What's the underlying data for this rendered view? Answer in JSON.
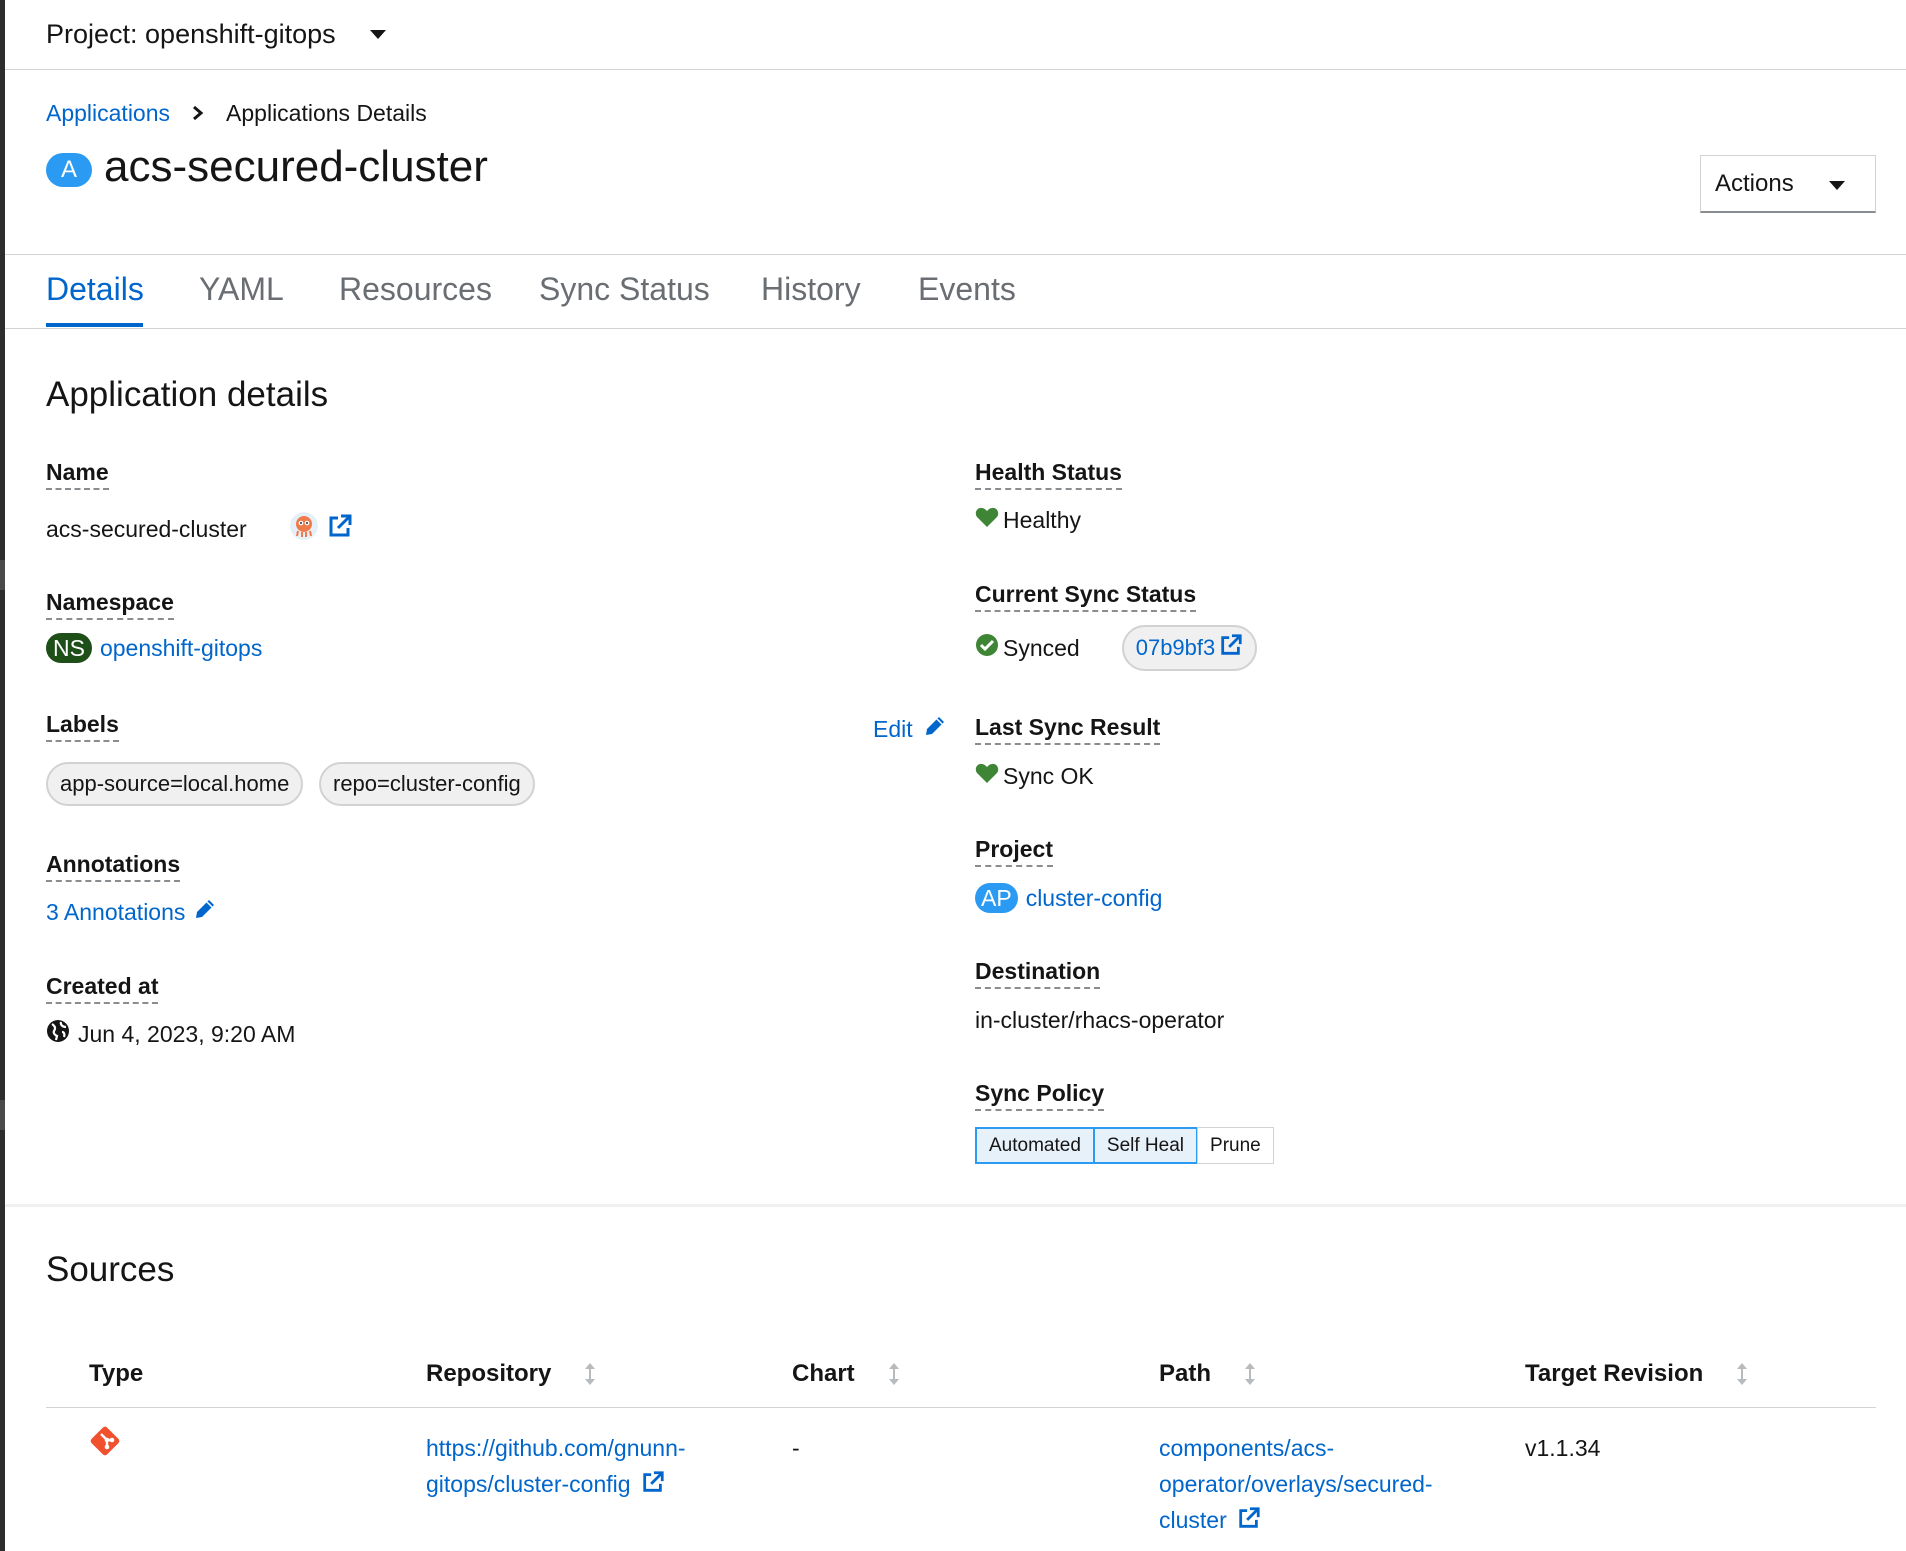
{
  "project_bar": {
    "label": "Project: openshift-gitops"
  },
  "breadcrumb": {
    "parent": "Applications",
    "current": "Applications Details"
  },
  "header": {
    "badge": "A",
    "title": "acs-secured-cluster",
    "actions_label": "Actions"
  },
  "tabs": [
    "Details",
    "YAML",
    "Resources",
    "Sync Status",
    "History",
    "Events"
  ],
  "details": {
    "heading": "Application details",
    "name": {
      "label": "Name",
      "value": "acs-secured-cluster"
    },
    "namespace": {
      "label": "Namespace",
      "badge": "NS",
      "value": "openshift-gitops"
    },
    "labels": {
      "label": "Labels",
      "edit": "Edit",
      "chips": [
        "app-source=local.home",
        "repo=cluster-config"
      ]
    },
    "annotations": {
      "label": "Annotations",
      "value": "3 Annotations"
    },
    "created_at": {
      "label": "Created at",
      "value": "Jun 4, 2023, 9:20 AM"
    },
    "health_status": {
      "label": "Health Status",
      "value": "Healthy"
    },
    "current_sync_status": {
      "label": "Current Sync Status",
      "value": "Synced",
      "revision": "07b9bf3"
    },
    "last_sync_result": {
      "label": "Last Sync Result",
      "value": "Sync OK"
    },
    "project": {
      "label": "Project",
      "badge": "AP",
      "value": "cluster-config"
    },
    "destination": {
      "label": "Destination",
      "value": "in-cluster/rhacs-operator"
    },
    "sync_policy": {
      "label": "Sync Policy",
      "options": [
        "Automated",
        "Self Heal",
        "Prune"
      ]
    }
  },
  "sources": {
    "heading": "Sources",
    "columns": [
      "Type",
      "Repository",
      "Chart",
      "Path",
      "Target Revision"
    ],
    "rows": [
      {
        "repository_line1": "https://github.com/gnunn-",
        "repository_line2": "gitops/cluster-config",
        "chart": "-",
        "path_line1": "components/acs-",
        "path_line2": "operator/overlays/secured-",
        "path_line3": "cluster",
        "target_revision": "v1.1.34"
      }
    ]
  },
  "colors": {
    "link": "#0066cc",
    "healthy": "#3e8635",
    "namespace_badge": "#1e4f18",
    "blue_badge": "#2b9af3",
    "git": "#f1502f"
  },
  "icons": [
    "caret-down-icon",
    "chevron-right-icon",
    "argo-icon",
    "external-link-icon",
    "pencil-icon",
    "globe-icon",
    "heart-icon",
    "check-circle-icon",
    "sort-icon",
    "git-icon"
  ]
}
